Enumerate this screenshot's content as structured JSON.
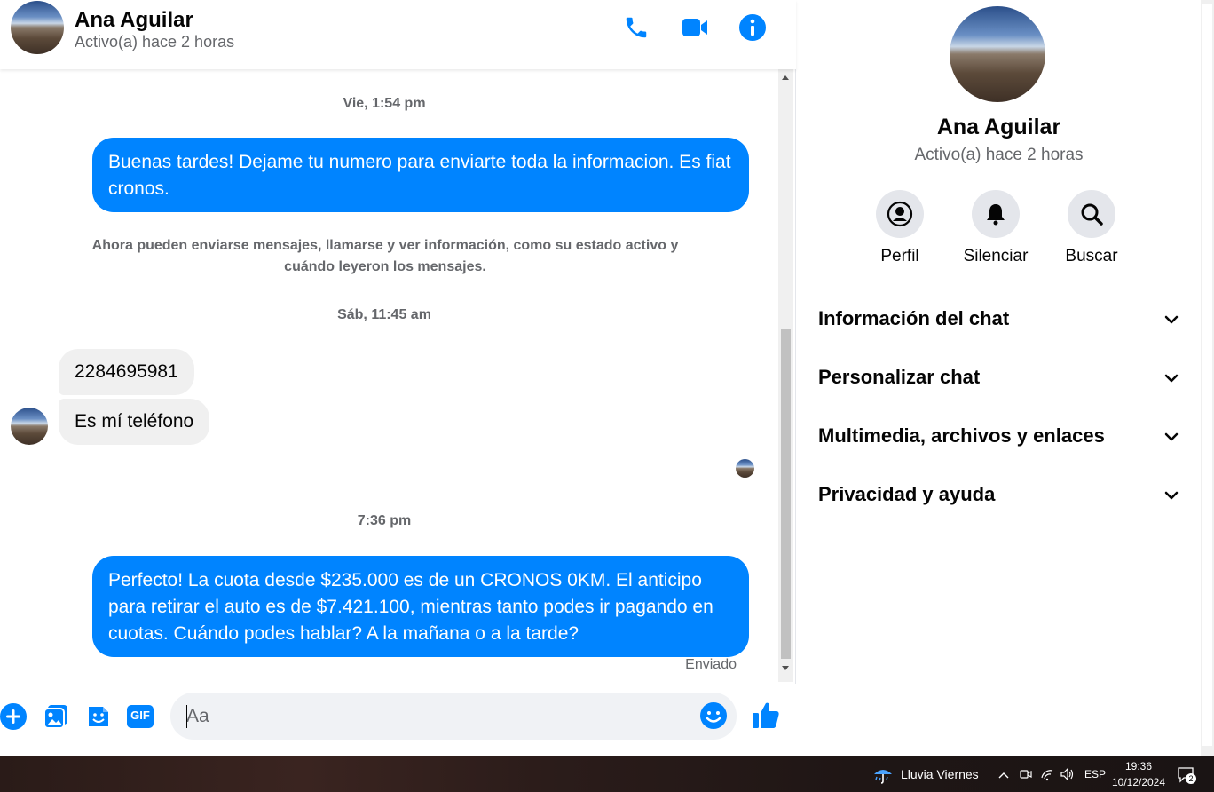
{
  "header": {
    "name": "Ana Aguilar",
    "status": "Activo(a) hace 2 horas",
    "icons": [
      "phone-icon",
      "video-icon",
      "info-icon"
    ]
  },
  "messages": {
    "ts1": "Vie, 1:54 pm",
    "out1": "Buenas tardes! Dejame tu numero para enviarte toda la informacion. Es fiat cronos.",
    "system": "Ahora pueden enviarse mensajes, llamarse y ver información, como su estado activo y cuándo leyeron los mensajes.",
    "ts2": "Sáb, 11:45 am",
    "in1": "2284695981",
    "in2": "Es mí teléfono",
    "ts3": "7:36 pm",
    "out2": "Perfecto! La cuota desde $235.000 es de un CRONOS 0KM. El anticipo para retirar el auto es de $7.421.100, mientras tanto podes ir pagando en cuotas. Cuándo podes hablar? A la mañana o a la tarde?",
    "sent": "Enviado"
  },
  "composer": {
    "placeholder": "Aa",
    "gif_label": "GIF"
  },
  "side": {
    "name": "Ana Aguilar",
    "status": "Activo(a) hace 2 horas",
    "actions": [
      {
        "label": "Perfil",
        "icon": "profile-icon"
      },
      {
        "label": "Silenciar",
        "icon": "bell-icon"
      },
      {
        "label": "Buscar",
        "icon": "search-icon"
      }
    ],
    "sections": [
      "Información del chat",
      "Personalizar chat",
      "Multimedia, archivos y enlaces",
      "Privacidad y ayuda"
    ]
  },
  "taskbar": {
    "weather": "Lluvia Viernes",
    "lang": "ESP",
    "time": "19:36",
    "date": "10/12/2024",
    "notifications": "2"
  },
  "colors": {
    "accent": "#0084ff",
    "bubble_in": "#f0f0f0",
    "muted": "#65676b"
  }
}
